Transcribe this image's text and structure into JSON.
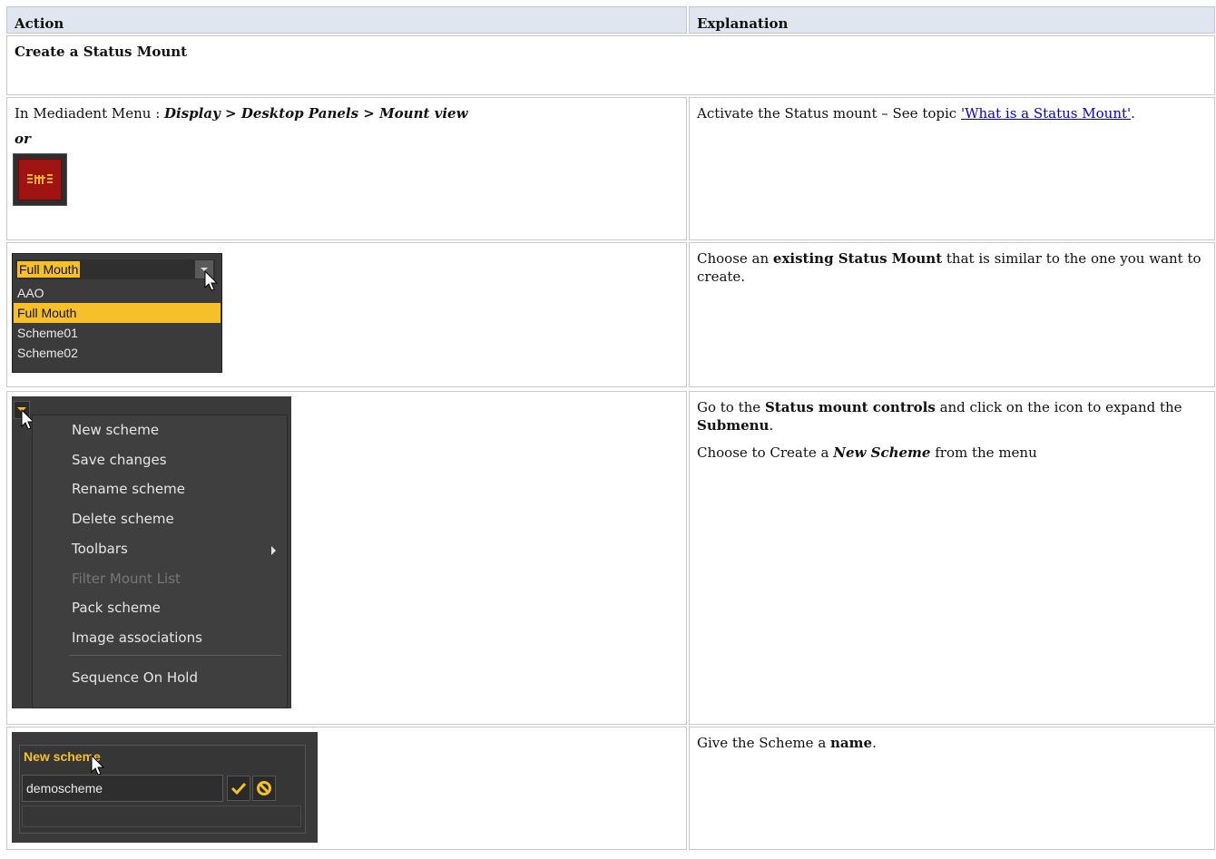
{
  "header": {
    "action": "Action",
    "explanation": "Explanation"
  },
  "section_title": "Create a Status Mount",
  "row1": {
    "prefix": "In Mediadent Menu : ",
    "path1": "Display",
    "sep1": " > ",
    "path2": "Desktop Panels",
    "sep2": " > ",
    "path3": "Mount view",
    "or": "or",
    "explain_prefix": "Activate the Status mount – See topic ",
    "explain_link": "'What is a Status Mount'",
    "explain_suffix": "."
  },
  "row2": {
    "selected": "Full Mouth",
    "options": [
      "AAO",
      "Full Mouth",
      "Scheme01",
      "Scheme02"
    ],
    "explain_a": "Choose an ",
    "explain_b": "existing Status Mount",
    "explain_c": " that is similar to the one you want to create."
  },
  "row3": {
    "menu": [
      "New scheme",
      "Save changes",
      "Rename scheme",
      "Delete scheme",
      "Toolbars",
      "Filter Mount List",
      "Pack scheme",
      "Image associations",
      "Sequence On Hold"
    ],
    "explain1_a": "Go to the ",
    "explain1_b": "Status mount controls",
    "explain1_c": " and click on the icon to expand the ",
    "explain1_d": "Submenu",
    "explain1_e": ".",
    "explain2_a": "Choose to Create a ",
    "explain2_b": "New Scheme",
    "explain2_c": " from the menu"
  },
  "row4": {
    "title": "New scheme",
    "value": "demoscheme",
    "explain_a": "Give the Scheme a ",
    "explain_b": "name",
    "explain_c": "."
  },
  "colors": {
    "header_bg": "#dfe6ef",
    "highlight": "#f5c02a",
    "dark_panel": "#3a3a3a",
    "link": "#0000ee"
  }
}
